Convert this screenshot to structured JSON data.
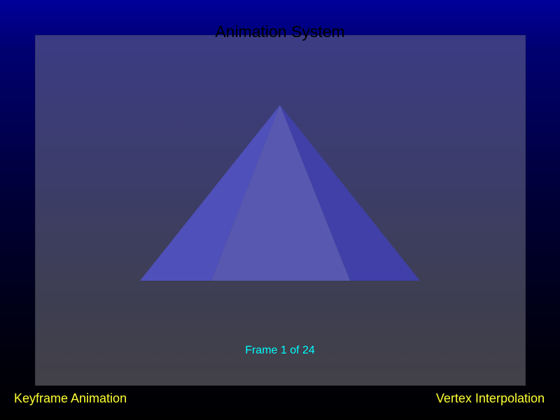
{
  "app": {
    "title": "Animation System"
  },
  "scene": {
    "frame_label": "Frame 1 of 24",
    "current_frame": 1,
    "total_frames": 24,
    "object": "pyramid"
  },
  "footer": {
    "left_label": "Keyframe Animation",
    "right_label": "Vertex Interpolation"
  },
  "colors": {
    "title_text": "#000000",
    "frame_text": "#00ffff",
    "caption_text": "#ffff33",
    "face_left": "#5050bb",
    "face_front": "#5858b0",
    "face_right": "#4040a8"
  }
}
